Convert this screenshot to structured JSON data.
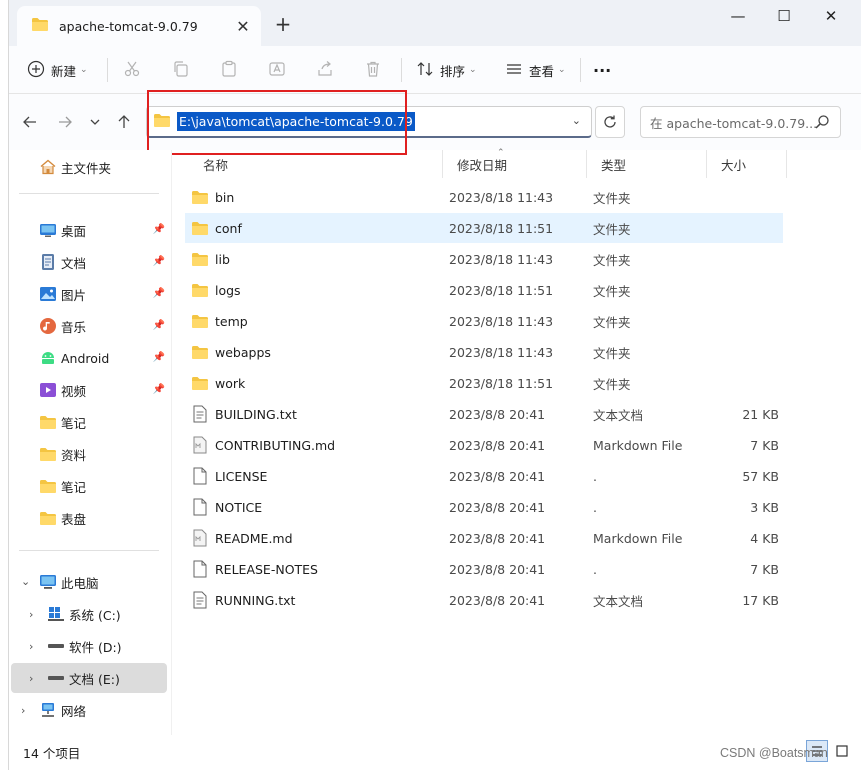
{
  "window": {
    "tab_title": "apache-tomcat-9.0.79",
    "tab_close": "✕",
    "new_tab": "+",
    "min": "—",
    "max": "☐",
    "close": "✕"
  },
  "toolbar": {
    "new_label": "新建",
    "sort_label": "排序",
    "view_label": "查看",
    "more": "···"
  },
  "address": {
    "path": "E:\\java\\tomcat\\apache-tomcat-9.0.79",
    "search_placeholder": "在 apache-tomcat-9.0.79..."
  },
  "sidebar": {
    "home": "主文件夹",
    "quick": [
      {
        "label": "桌面",
        "icon": "desktop-icon"
      },
      {
        "label": "文档",
        "icon": "documents-icon"
      },
      {
        "label": "图片",
        "icon": "pictures-icon"
      },
      {
        "label": "音乐",
        "icon": "music-icon"
      },
      {
        "label": "Android",
        "icon": "android-icon"
      },
      {
        "label": "视频",
        "icon": "videos-icon"
      },
      {
        "label": "笔记",
        "icon": "folder-icon"
      },
      {
        "label": "资料",
        "icon": "folder-icon"
      },
      {
        "label": "笔记",
        "icon": "folder-icon"
      },
      {
        "label": "表盘",
        "icon": "folder-icon"
      }
    ],
    "this_pc": "此电脑",
    "drives": [
      {
        "label": "系统 (C:)"
      },
      {
        "label": "软件 (D:)"
      },
      {
        "label": "文档 (E:)"
      }
    ],
    "network": "网络"
  },
  "columns": {
    "name": "名称",
    "date": "修改日期",
    "type": "类型",
    "size": "大小"
  },
  "files": [
    {
      "name": "bin",
      "date": "2023/8/18 11:43",
      "type": "文件夹",
      "size": "",
      "kind": "folder"
    },
    {
      "name": "conf",
      "date": "2023/8/18 11:51",
      "type": "文件夹",
      "size": "",
      "kind": "folder"
    },
    {
      "name": "lib",
      "date": "2023/8/18 11:43",
      "type": "文件夹",
      "size": "",
      "kind": "folder"
    },
    {
      "name": "logs",
      "date": "2023/8/18 11:51",
      "type": "文件夹",
      "size": "",
      "kind": "folder"
    },
    {
      "name": "temp",
      "date": "2023/8/18 11:43",
      "type": "文件夹",
      "size": "",
      "kind": "folder"
    },
    {
      "name": "webapps",
      "date": "2023/8/18 11:43",
      "type": "文件夹",
      "size": "",
      "kind": "folder"
    },
    {
      "name": "work",
      "date": "2023/8/18 11:51",
      "type": "文件夹",
      "size": "",
      "kind": "folder"
    },
    {
      "name": "BUILDING.txt",
      "date": "2023/8/8 20:41",
      "type": "文本文档",
      "size": "21 KB",
      "kind": "text"
    },
    {
      "name": "CONTRIBUTING.md",
      "date": "2023/8/8 20:41",
      "type": "Markdown File",
      "size": "7 KB",
      "kind": "md"
    },
    {
      "name": "LICENSE",
      "date": "2023/8/8 20:41",
      "type": ".",
      "size": "57 KB",
      "kind": "file"
    },
    {
      "name": "NOTICE",
      "date": "2023/8/8 20:41",
      "type": ".",
      "size": "3 KB",
      "kind": "file"
    },
    {
      "name": "README.md",
      "date": "2023/8/8 20:41",
      "type": "Markdown File",
      "size": "4 KB",
      "kind": "md"
    },
    {
      "name": "RELEASE-NOTES",
      "date": "2023/8/8 20:41",
      "type": ".",
      "size": "7 KB",
      "kind": "file"
    },
    {
      "name": "RUNNING.txt",
      "date": "2023/8/8 20:41",
      "type": "文本文档",
      "size": "17 KB",
      "kind": "text"
    }
  ],
  "selected_file_index": 1,
  "status": {
    "count": "14 个项目"
  },
  "watermark": "CSDN @Boatsman",
  "colors": {
    "accent": "#0a59c7",
    "folder": "#f4c542",
    "highlight_box": "#e02020",
    "selection": "#e5f3ff"
  }
}
